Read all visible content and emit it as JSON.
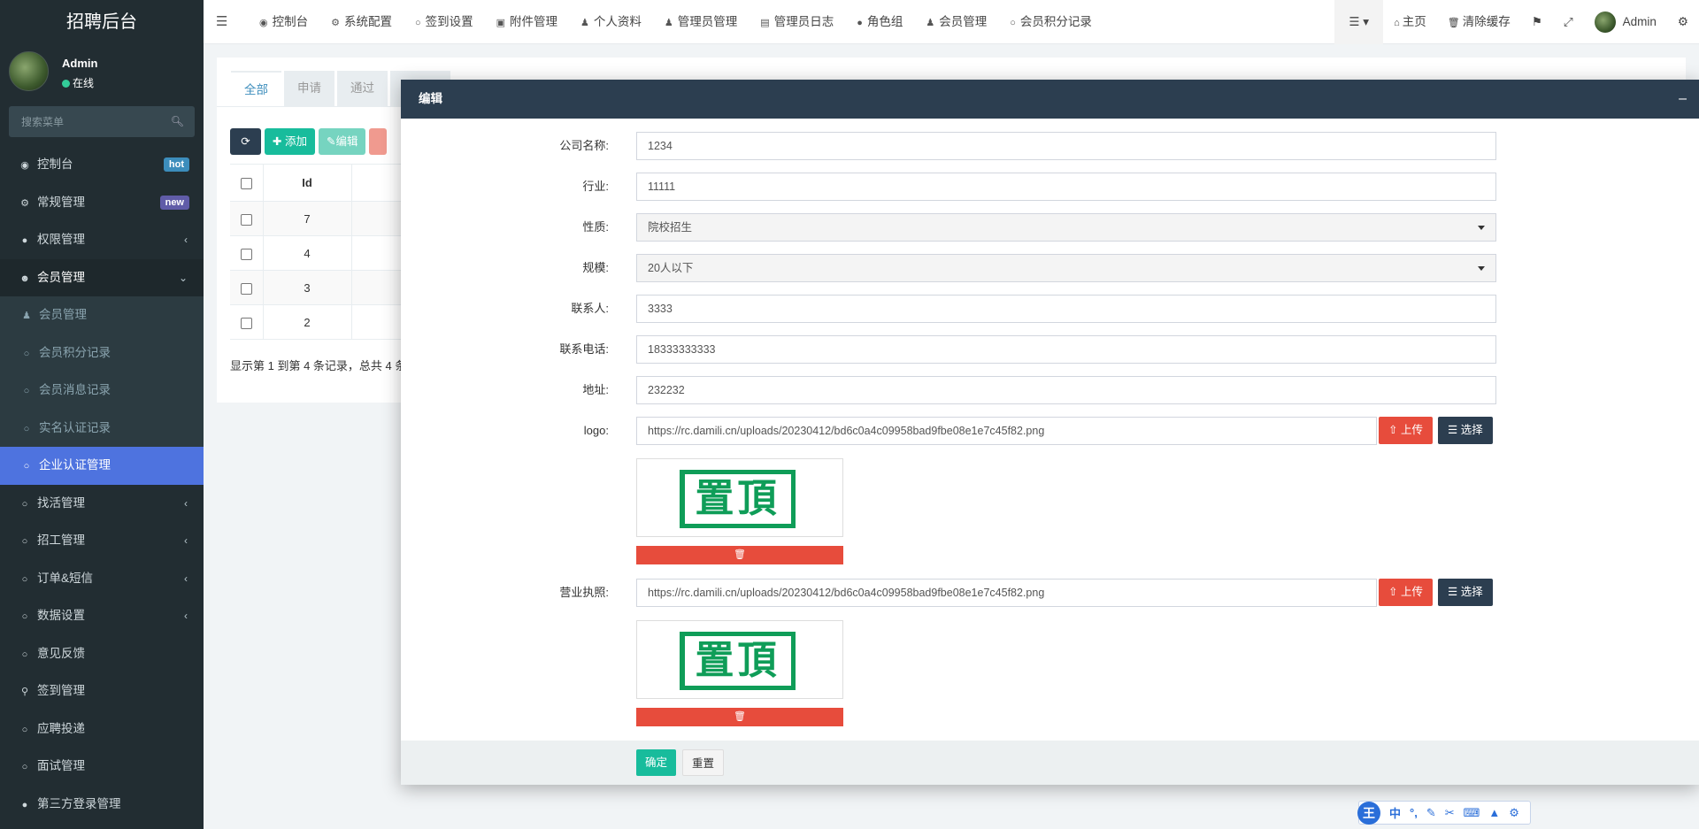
{
  "sidebar": {
    "logo": "招聘后台",
    "user": {
      "name": "Admin",
      "status": "在线"
    },
    "search_placeholder": "搜索菜单",
    "items": [
      {
        "label": "控制台",
        "badge": "hot"
      },
      {
        "label": "常规管理",
        "badge": "new"
      },
      {
        "label": "权限管理"
      },
      {
        "label": "会员管理"
      },
      {
        "label": "会员管理"
      },
      {
        "label": "会员积分记录"
      },
      {
        "label": "会员消息记录"
      },
      {
        "label": "实名认证记录"
      },
      {
        "label": "企业认证管理"
      },
      {
        "label": "找活管理"
      },
      {
        "label": "招工管理"
      },
      {
        "label": "订单&短信"
      },
      {
        "label": "数据设置"
      },
      {
        "label": "意见反馈"
      },
      {
        "label": "签到管理"
      },
      {
        "label": "应聘投递"
      },
      {
        "label": "面试管理"
      },
      {
        "label": "第三方登录管理"
      }
    ]
  },
  "navbar": {
    "tabs": [
      "控制台",
      "系统配置",
      "签到设置",
      "附件管理",
      "个人资料",
      "管理员管理",
      "管理员日志",
      "角色组",
      "会员管理",
      "会员积分记录"
    ],
    "right": {
      "home": "主页",
      "clear_cache": "清除缓存",
      "user": "Admin"
    }
  },
  "content": {
    "tabs": [
      "全部",
      "申请",
      "通过",
      ""
    ],
    "toolbar": {
      "add": "添加",
      "edit": "编辑"
    },
    "table": {
      "header_id": "Id",
      "rows": [
        {
          "id": "7"
        },
        {
          "id": "4"
        },
        {
          "id": "3"
        },
        {
          "id": "2"
        }
      ]
    },
    "pager_text": "显示第 1 到第 4 条记录，总共 4 条"
  },
  "modal": {
    "title": "编辑",
    "fields": {
      "company_label": "公司名称:",
      "company_value": "1234",
      "industry_label": "行业:",
      "industry_value": "11111",
      "nature_label": "性质:",
      "nature_value": "院校招生",
      "scale_label": "规模:",
      "scale_value": "20人以下",
      "contact_label": "联系人:",
      "contact_value": "3333",
      "phone_label": "联系电话:",
      "phone_value": "18333333333",
      "address_label": "地址:",
      "address_value": "232232",
      "logo_label": "logo:",
      "logo_value": "https://rc.damili.cn/uploads/20230412/bd6c0a4c09958bad9fbe08e1e7c45f82.png",
      "license_label": "营业执照:",
      "license_value": "https://rc.damili.cn/uploads/20230412/bd6c0a4c09958bad9fbe08e1e7c45f82.png"
    },
    "upload_label": "上传",
    "choose_label": "选择",
    "preview_text": "置頂",
    "confirm_label": "确定",
    "reset_label": "重置"
  },
  "ime": {
    "logo": "王",
    "lang": "中"
  }
}
